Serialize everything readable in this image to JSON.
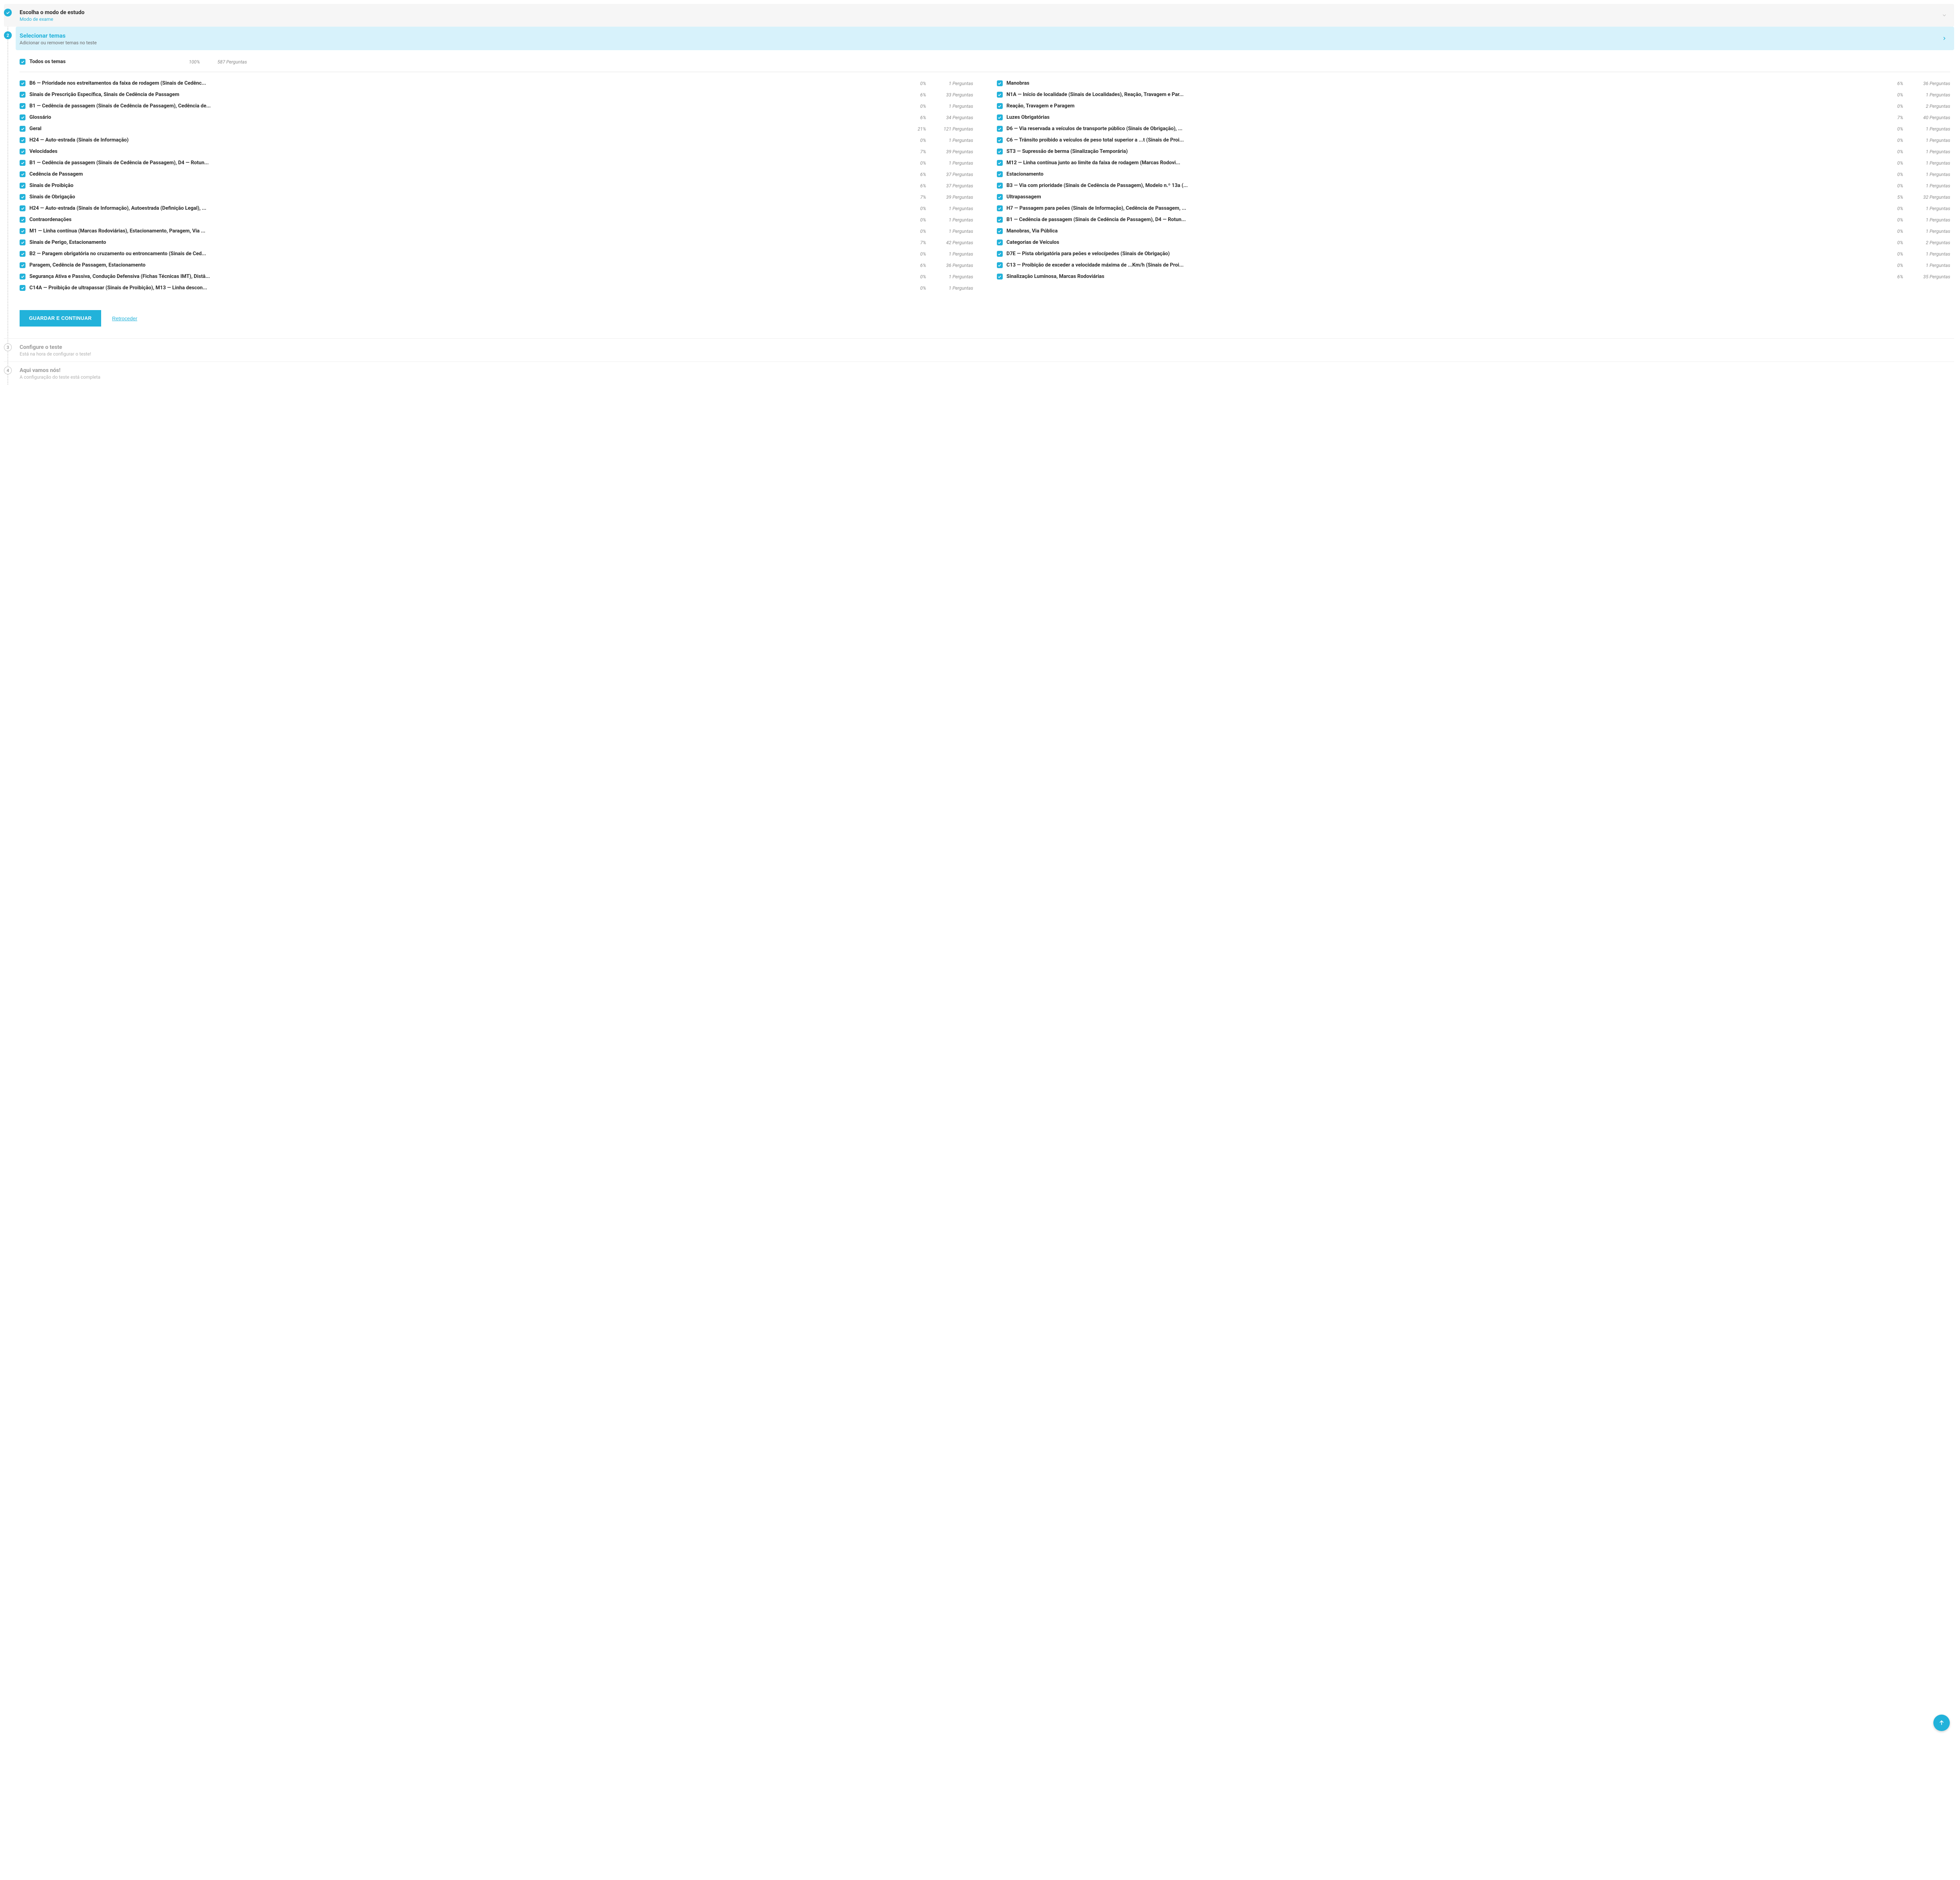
{
  "steps": {
    "s1": {
      "title": "Escolha o modo de estudo",
      "sub": "Modo de exame"
    },
    "s2": {
      "num": "2",
      "title": "Selecionar temas",
      "sub": "Adicionar ou remover temas no teste"
    },
    "s3": {
      "num": "3",
      "title": "Configure o teste",
      "sub": "Está na hora de configurar o teste!"
    },
    "s4": {
      "num": "4",
      "title": "Aqui vamos nós!",
      "sub": "A configuração do teste está completa"
    }
  },
  "all": {
    "label": "Todos os temas",
    "pct": "100%",
    "q": "587 Perguntas"
  },
  "left": [
    {
      "label": "B6 — Prioridade nos estreitamentos da faixa de rodagem (Sinais de Cedênc...",
      "pct": "0%",
      "q": "1 Perguntas"
    },
    {
      "label": "Sinais de Prescrição Específica, Sinais de Cedência de Passagem",
      "pct": "6%",
      "q": "33 Perguntas"
    },
    {
      "label": "B1 — Cedência de passagem (Sinais de Cedência de Passagem), Cedência de...",
      "pct": "0%",
      "q": "1 Perguntas"
    },
    {
      "label": "Glossário",
      "pct": "6%",
      "q": "34 Perguntas"
    },
    {
      "label": "Geral",
      "pct": "21%",
      "q": "121 Perguntas"
    },
    {
      "label": "H24 — Auto-estrada (Sinais de Informação)",
      "pct": "0%",
      "q": "1 Perguntas"
    },
    {
      "label": "Velocidades",
      "pct": "7%",
      "q": "39 Perguntas"
    },
    {
      "label": "B1 — Cedência de passagem (Sinais de Cedência de Passagem), D4 — Rotun...",
      "pct": "0%",
      "q": "1 Perguntas"
    },
    {
      "label": "Cedência de Passagem",
      "pct": "6%",
      "q": "37 Perguntas"
    },
    {
      "label": "Sinais de Proibição",
      "pct": "6%",
      "q": "37 Perguntas"
    },
    {
      "label": "Sinais de Obrigação",
      "pct": "7%",
      "q": "39 Perguntas"
    },
    {
      "label": "H24 — Auto-estrada (Sinais de Informação), Autoestrada (Definição Legal), ...",
      "pct": "0%",
      "q": "1 Perguntas"
    },
    {
      "label": "Contraordenações",
      "pct": "0%",
      "q": "1 Perguntas"
    },
    {
      "label": "M1 — Linha contínua (Marcas Rodoviárias), Estacionamento, Paragem, Via ...",
      "pct": "0%",
      "q": "1 Perguntas"
    },
    {
      "label": "Sinais de Perigo, Estacionamento",
      "pct": "7%",
      "q": "42 Perguntas"
    },
    {
      "label": "B2 — Paragem obrigatória no cruzamento ou entroncamento (Sinais de Ced...",
      "pct": "0%",
      "q": "1 Perguntas"
    },
    {
      "label": "Paragem, Cedência de Passagem, Estacionamento",
      "pct": "6%",
      "q": "36 Perguntas"
    },
    {
      "label": "Segurança Ativa e Passiva, Condução Defensiva (Fichas Técnicas IMT), Distâ...",
      "pct": "0%",
      "q": "1 Perguntas"
    },
    {
      "label": "C14A — Proibição de ultrapassar (Sinais de Proibição), M13 — Linha descon...",
      "pct": "0%",
      "q": "1 Perguntas"
    }
  ],
  "right": [
    {
      "label": "Manobras",
      "pct": "6%",
      "q": "36 Perguntas"
    },
    {
      "label": "N1A — Início de localidade (Sinais de Localidades), Reação, Travagem e Par...",
      "pct": "0%",
      "q": "1 Perguntas"
    },
    {
      "label": "Reação, Travagem e Paragem",
      "pct": "0%",
      "q": "2 Perguntas"
    },
    {
      "label": "Luzes Obrigatórias",
      "pct": "7%",
      "q": "40 Perguntas"
    },
    {
      "label": "D6 — Via reservada a veículos de transporte público (Sinais de Obrigação), ...",
      "pct": "0%",
      "q": "1 Perguntas"
    },
    {
      "label": "C6 — Trânsito proibido a veículos de peso total superior a ...t (Sinais de Proi...",
      "pct": "0%",
      "q": "1 Perguntas"
    },
    {
      "label": "ST3 — Supressão de berma (Sinalização Temporária)",
      "pct": "0%",
      "q": "1 Perguntas"
    },
    {
      "label": "M12 — Linha contínua junto ao limite da faixa de rodagem (Marcas Rodovi...",
      "pct": "0%",
      "q": "1 Perguntas"
    },
    {
      "label": "Estacionamento",
      "pct": "0%",
      "q": "1 Perguntas"
    },
    {
      "label": "B3 — Via com prioridade (Sinais de Cedência de Passagem), Modelo n.º 13a (...",
      "pct": "0%",
      "q": "1 Perguntas"
    },
    {
      "label": "Ultrapassagem",
      "pct": "5%",
      "q": "32 Perguntas"
    },
    {
      "label": "H7 — Passagem para peões (Sinais de Informação), Cedência de Passagem, ...",
      "pct": "0%",
      "q": "1 Perguntas"
    },
    {
      "label": "B1 — Cedência de passagem (Sinais de Cedência de Passagem), D4 — Rotun...",
      "pct": "0%",
      "q": "1 Perguntas"
    },
    {
      "label": "Manobras, Via Pública",
      "pct": "0%",
      "q": "1 Perguntas"
    },
    {
      "label": "Categorias de Veículos",
      "pct": "0%",
      "q": "2 Perguntas"
    },
    {
      "label": "D7E — Pista obrigatória para peões e velocípedes (Sinais de Obrigação)",
      "pct": "0%",
      "q": "1 Perguntas"
    },
    {
      "label": "C13 — Proibição de exceder a velocidade máxima de ...Km/h (Sinais de Proi...",
      "pct": "0%",
      "q": "1 Perguntas"
    },
    {
      "label": "Sinalização Luminosa, Marcas Rodoviárias",
      "pct": "6%",
      "q": "35 Perguntas"
    }
  ],
  "actions": {
    "primary": "GUARDAR E CONTINUAR",
    "back": "Retroceder"
  }
}
